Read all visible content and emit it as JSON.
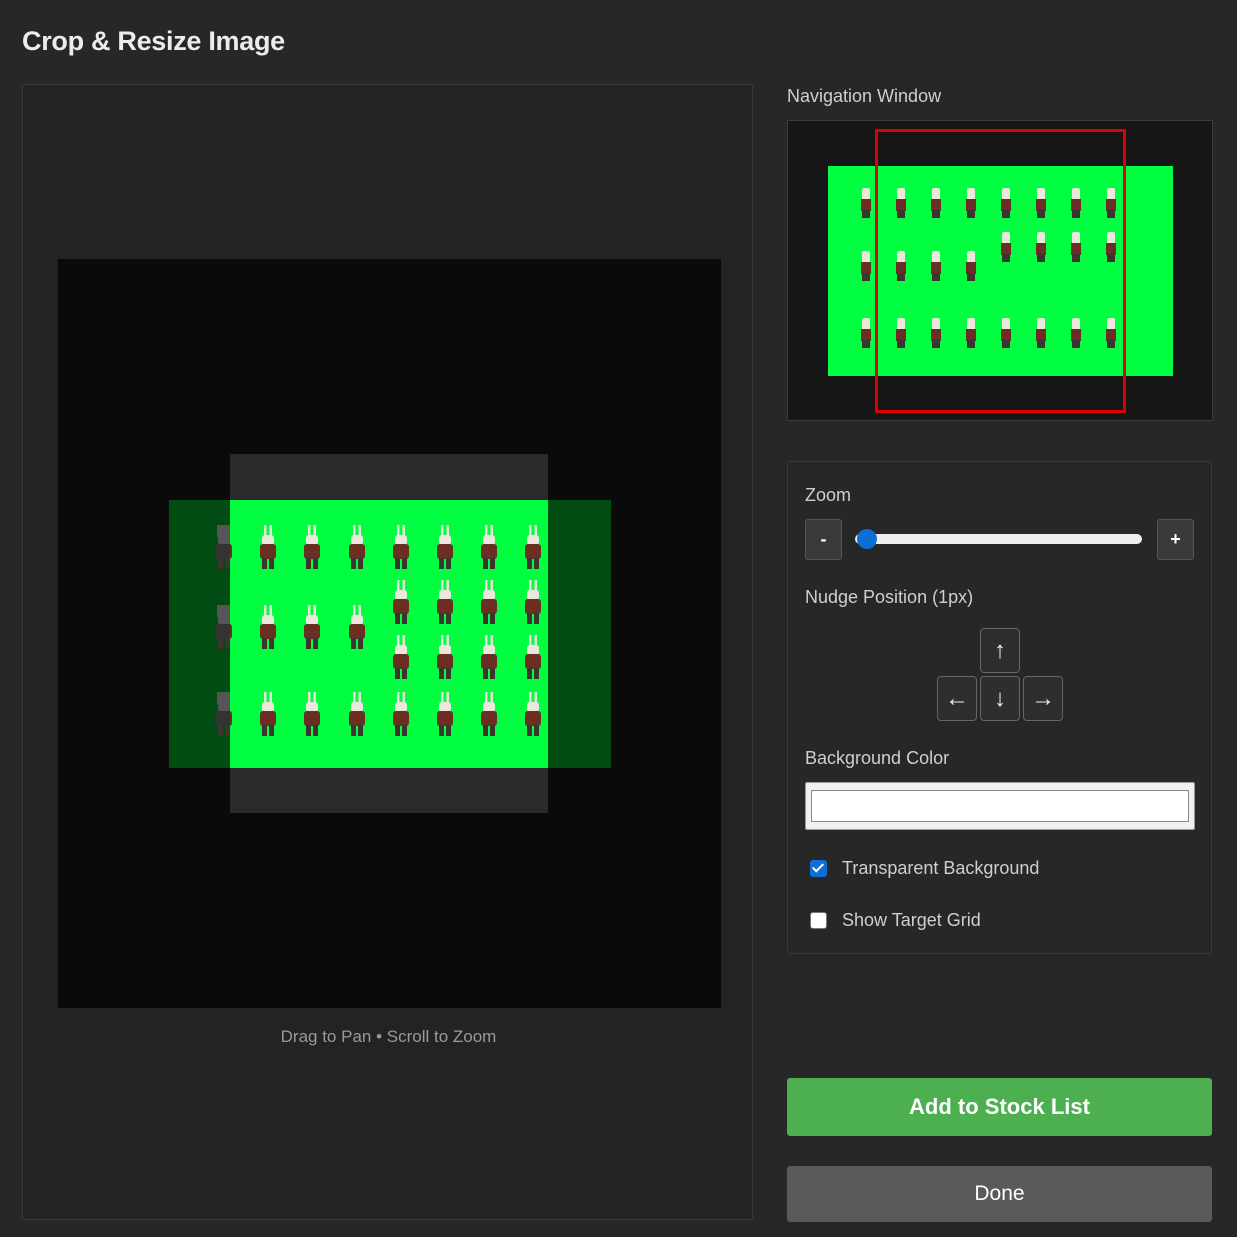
{
  "window": {
    "title": "Crop & Resize Image"
  },
  "canvas": {
    "hint": "Drag to Pan • Scroll to Zoom"
  },
  "navigation": {
    "label": "Navigation Window"
  },
  "zoom": {
    "label": "Zoom",
    "minus": "-",
    "plus": "+"
  },
  "nudge": {
    "label": "Nudge Position (1px)",
    "up": "↑",
    "left": "←",
    "down": "↓",
    "right": "→"
  },
  "background": {
    "label": "Background Color",
    "value": ""
  },
  "options": {
    "transparent": {
      "label": "Transparent Background",
      "checked": true
    },
    "grid": {
      "label": "Show Target Grid",
      "checked": false
    }
  },
  "actions": {
    "add": "Add to Stock List",
    "done": "Done"
  },
  "colors": {
    "accent": "#4caf50",
    "image_background": "#00ff40",
    "nav_viewport": "#dd0000",
    "slider": "#0d6fd6"
  }
}
